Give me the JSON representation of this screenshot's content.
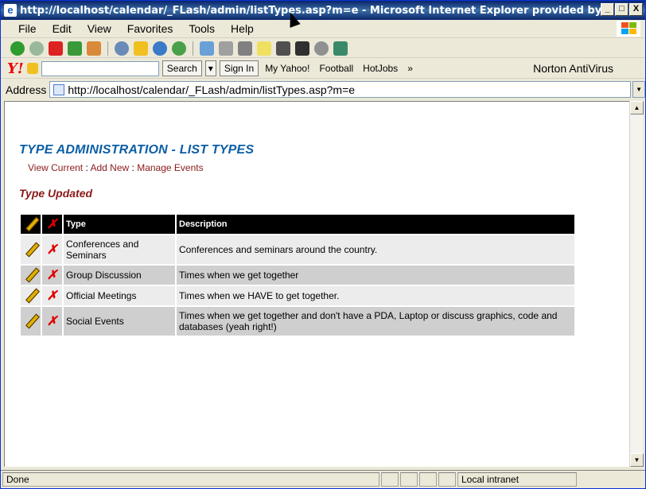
{
  "window": {
    "title": "http://localhost/calendar/_FLash/admin/listTypes.asp?m=e - Microsoft Internet Explorer provided by ...",
    "minimize_label": "_",
    "maximize_label": "□",
    "close_label": "X"
  },
  "menu": {
    "items": [
      "File",
      "Edit",
      "View",
      "Favorites",
      "Tools",
      "Help"
    ]
  },
  "yahoo": {
    "logo": "Y!",
    "search_label": "Search",
    "signin_label": "Sign In",
    "myyahoo_label": "My Yahoo!",
    "football_label": "Football",
    "hotjobs_label": "HotJobs",
    "more_label": "»",
    "norton_label": "Norton AntiVirus"
  },
  "address": {
    "label": "Address",
    "url": "http://localhost/calendar/_FLash/admin/listTypes.asp?m=e"
  },
  "page": {
    "heading": "TYPE ADMINISTRATION - LIST TYPES",
    "links": [
      "View Current",
      "Add New",
      "Manage Events"
    ],
    "link_separator": " : ",
    "status_message": "Type Updated",
    "table": {
      "headers": [
        "Type",
        "Description"
      ],
      "rows": [
        {
          "type": "Conferences and Seminars",
          "description": "Conferences and seminars around the country."
        },
        {
          "type": "Group Discussion",
          "description": "Times when we get together"
        },
        {
          "type": "Official Meetings",
          "description": "Times when we HAVE to get together."
        },
        {
          "type": "Social Events",
          "description": "Times when we get together and don't have a PDA, Laptop or discuss graphics, code and databases (yeah right!)"
        }
      ]
    }
  },
  "statusbar": {
    "status": "Done",
    "zone": "Local intranet"
  },
  "colors": {
    "heading": "#0b5ea7",
    "link": "#8b1a1a",
    "status_message": "#8b1a1a",
    "delete_icon": "#e00000"
  }
}
